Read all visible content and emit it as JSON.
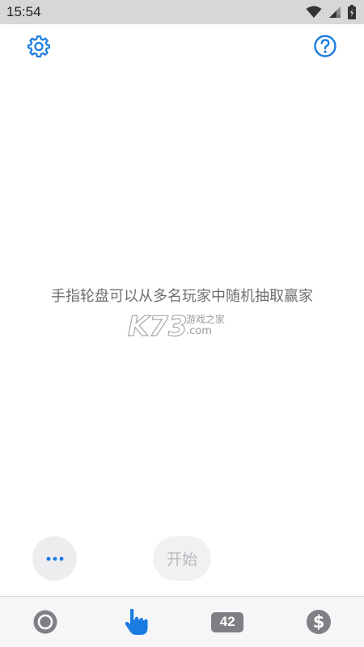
{
  "status_bar": {
    "time": "15:54",
    "icons": [
      "wifi-icon",
      "cellular-signal-icon",
      "battery-icon"
    ]
  },
  "header": {
    "left_icon": "gear-icon",
    "right_icon": "help-icon"
  },
  "main": {
    "hint": "手指轮盘可以从多名玩家中随机抽取赢家"
  },
  "watermark": {
    "brand": "K73",
    "site_text": "游戏之家",
    "domain": ".com"
  },
  "controls": {
    "more_icon": "more-dots-icon",
    "start_label": "开始"
  },
  "tab_bar": {
    "tabs": [
      {
        "icon": "circle-ring-icon",
        "active": false
      },
      {
        "icon": "pointing-finger-icon",
        "active": true
      },
      {
        "icon": "number-badge",
        "label": "42",
        "active": false
      },
      {
        "icon": "dollar-icon",
        "active": false
      }
    ]
  },
  "colors": {
    "accent": "#1a7be0",
    "inactive_icon": "#7f7f84",
    "status_bar_bg": "#d7d7d7",
    "hint_text": "#6f6f6f"
  }
}
